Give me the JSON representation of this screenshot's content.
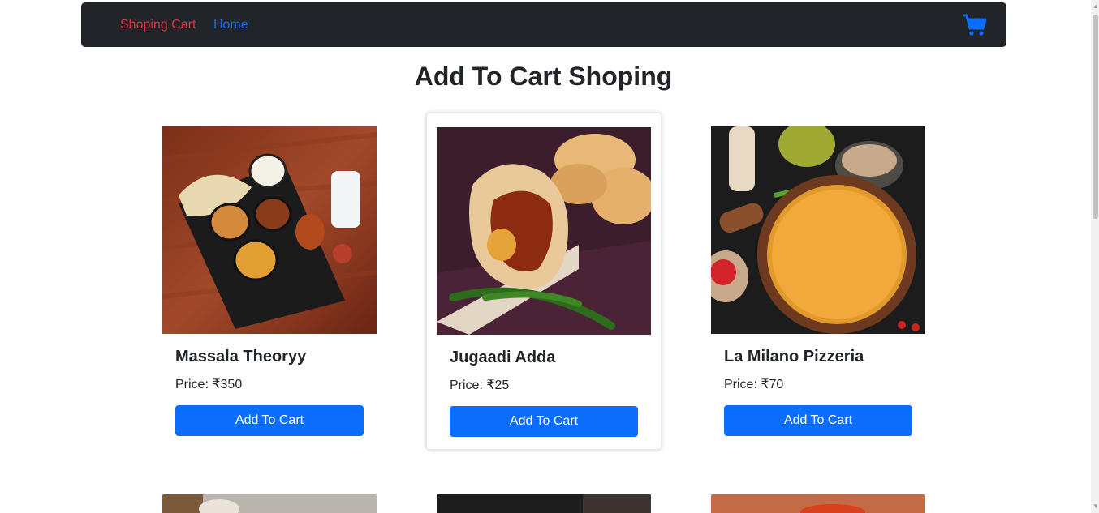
{
  "navbar": {
    "brand": "Shoping Cart",
    "home_link": "Home",
    "cart_icon": "shopping-cart-icon",
    "colors": {
      "background": "#212529",
      "brand": "#dc3545",
      "link": "#0d6efd"
    }
  },
  "page": {
    "title": "Add To Cart Shoping"
  },
  "products": [
    {
      "name": "Massala Theoryy",
      "price": "Price: ₹350",
      "button": "Add To Cart"
    },
    {
      "name": "Jugaadi Adda",
      "price": "Price: ₹25",
      "button": "Add To Cart"
    },
    {
      "name": "La Milano Pizzeria",
      "price": "Price: ₹70",
      "button": "Add To Cart"
    }
  ],
  "theme": {
    "button_color": "#0d6efd"
  }
}
